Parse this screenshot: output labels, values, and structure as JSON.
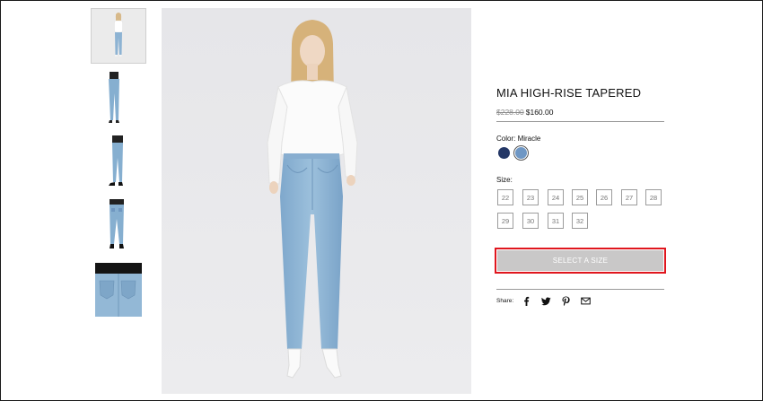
{
  "product": {
    "title": "MIA HIGH-RISE TAPERED",
    "price_original": "$228.00",
    "price_sale": "$160.00",
    "color_label": "Color: Miracle",
    "swatches": [
      {
        "name": "dark-indigo",
        "color": "#243766",
        "selected": false
      },
      {
        "name": "miracle",
        "color": "#6f97c4",
        "selected": true
      }
    ],
    "size_label": "Size:",
    "sizes": [
      "22",
      "23",
      "24",
      "25",
      "26",
      "27",
      "28",
      "29",
      "30",
      "31",
      "32"
    ],
    "cta_label": "SELECT A SIZE"
  },
  "share": {
    "label": "Share:",
    "icons": [
      "facebook-icon",
      "twitter-icon",
      "pinterest-icon",
      "email-icon"
    ]
  },
  "gallery": {
    "thumbnails": [
      "front-view",
      "side-view",
      "side-profile",
      "back-view",
      "back-pocket-detail"
    ]
  },
  "colors": {
    "highlight": "#e0161e",
    "button_bg": "#c9c8c8",
    "denim": "#8db3d3"
  }
}
